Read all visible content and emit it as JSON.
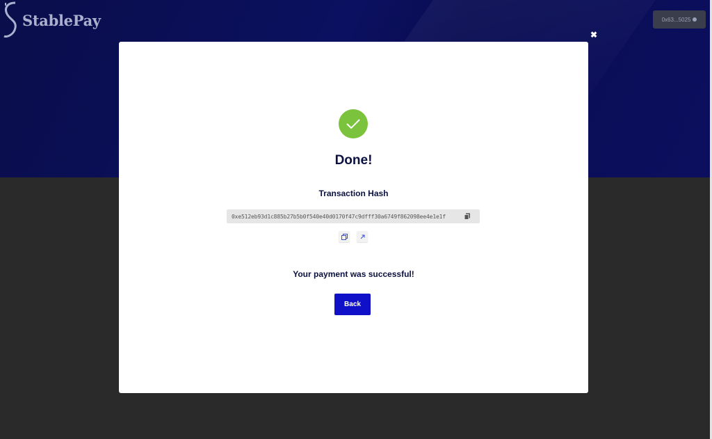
{
  "header": {
    "logo_text": "StablePay",
    "wallet_label": "0x63...5025"
  },
  "modal": {
    "close_symbol": "✖",
    "title": "Done!",
    "hash_label": "Transaction Hash",
    "hash_value": "0xe512eb93d1c885b27b5b0f540e40d0170f47c9dfff30a6749f862098ee4e1e1f",
    "success_message": "Your payment was successful!",
    "back_label": "Back"
  },
  "colors": {
    "hero_bg": "#0b1060",
    "success_green": "#7bc33d",
    "primary_button": "#1010c8",
    "text_dark": "#0b1140"
  },
  "icons": {
    "logo": "stablepay-s-logo-icon",
    "success": "checkmark-icon",
    "copy": "copy-icon",
    "open": "external-link-icon",
    "close": "close-icon"
  }
}
